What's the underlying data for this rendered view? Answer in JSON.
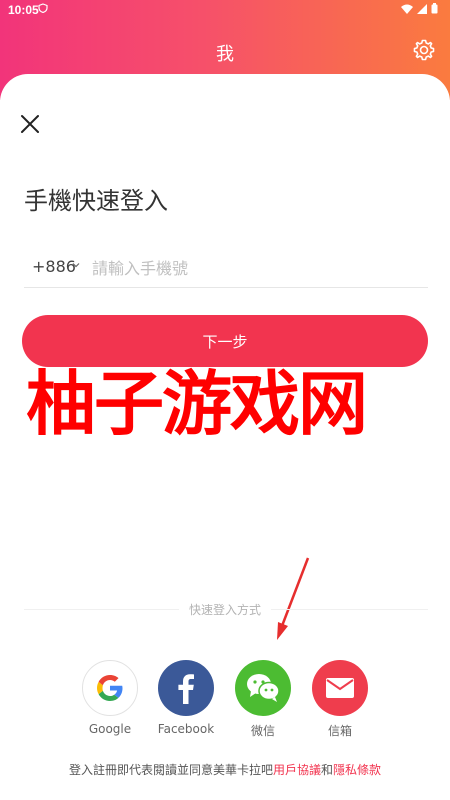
{
  "status": {
    "time": "10:05"
  },
  "nav": {
    "title": "我"
  },
  "login": {
    "title": "手機快速登入",
    "country_code": "+886",
    "phone_placeholder": "請輸入手機號",
    "next_label": "下一步"
  },
  "watermark": "柚子游戏网",
  "quick": {
    "divider": "快速登入方式"
  },
  "social": [
    {
      "label": "Google",
      "icon": "google-icon"
    },
    {
      "label": "Facebook",
      "icon": "facebook-icon"
    },
    {
      "label": "微信",
      "icon": "wechat-icon"
    },
    {
      "label": "信箱",
      "icon": "mail-icon"
    }
  ],
  "agreement": {
    "prefix": "登入註冊即代表閱讀並同意美華卡拉吧",
    "user_terms": "用戶協議",
    "and": "和",
    "privacy": "隱私條款"
  },
  "colors": {
    "accent": "#f2344f",
    "gradient_start": "#f2347a",
    "gradient_end": "#fa7b3f",
    "watermark": "#ff0000"
  }
}
